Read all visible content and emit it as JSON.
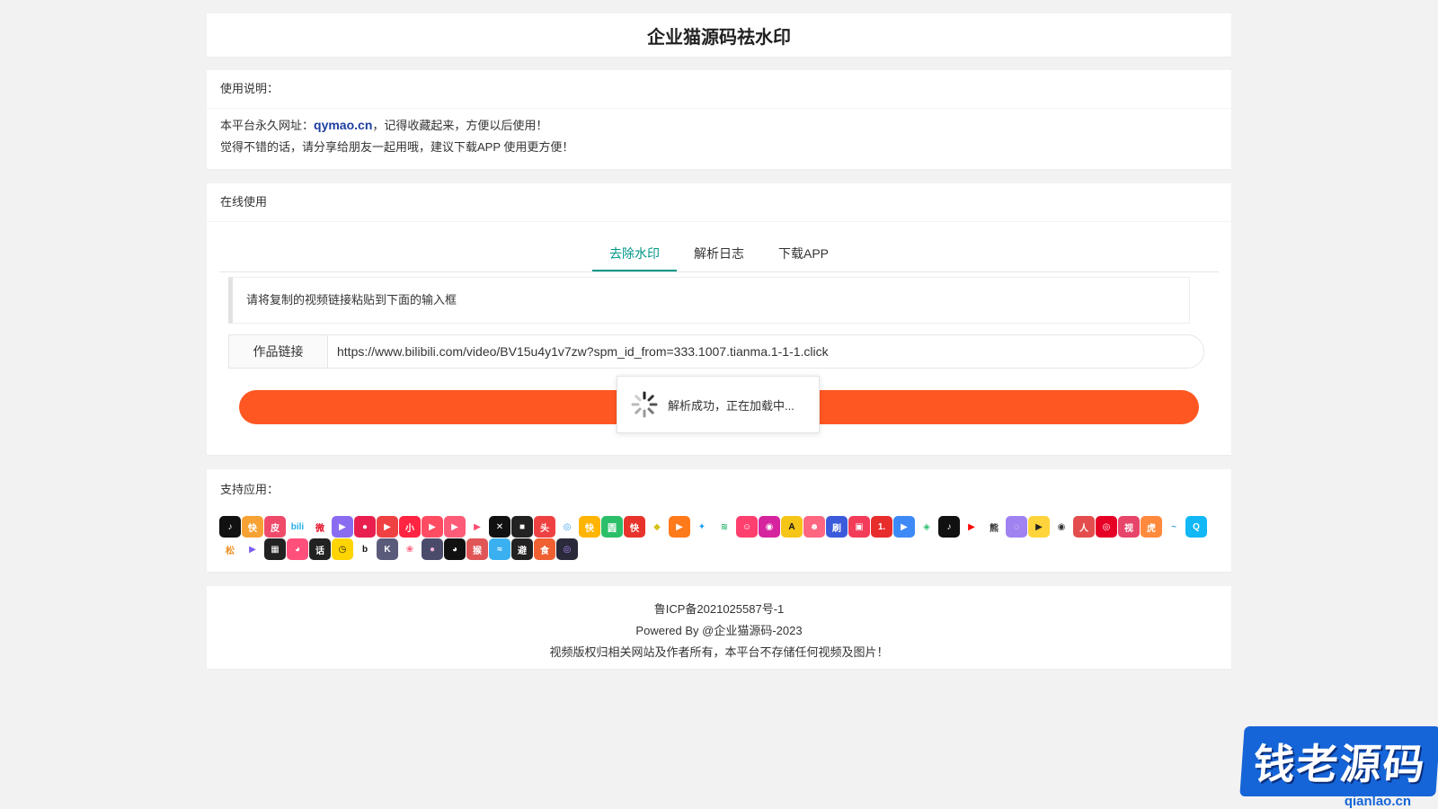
{
  "header": {
    "title": "企业猫源码祛水印"
  },
  "usage": {
    "heading": "使用说明：",
    "line1_prefix": "本平台永久网址：",
    "line1_link": "qymao.cn",
    "line1_suffix": "，记得收藏起来，方便以后使用！",
    "line2": "觉得不错的话，请分享给朋友一起用哦，建议下载APP 使用更方便！"
  },
  "online": {
    "heading": "在线使用",
    "tabs": [
      {
        "label": "去除水印",
        "active": true
      },
      {
        "label": "解析日志",
        "active": false
      },
      {
        "label": "下载APP",
        "active": false
      }
    ],
    "notice": "请将复制的视频链接粘贴到下面的输入框",
    "input_label": "作品链接",
    "input_value": "https://www.bilibili.com/video/BV15u4y1v7zw?spm_id_from=333.1007.tianma.1-1-1.click",
    "loading_text": "解析成功，正在加载中..."
  },
  "apps": {
    "heading": "支持应用：",
    "icons": [
      {
        "name": "douyin-icon",
        "glyph": "♪",
        "color": "#111111"
      },
      {
        "name": "kuaishou-icon",
        "glyph": "快",
        "color": "#f7a234"
      },
      {
        "name": "pipi-icon",
        "glyph": "皮",
        "color": "#ef4a6a"
      },
      {
        "name": "bilibili-icon",
        "glyph": "bili",
        "color": "#ffffff",
        "fg": "#23ade5"
      },
      {
        "name": "weibo-icon",
        "glyph": "微",
        "color": "#ffffff",
        "fg": "#e6162d"
      },
      {
        "name": "video-play-icon",
        "glyph": "▶",
        "color": "#8a6cf0"
      },
      {
        "name": "momo-icon",
        "glyph": "●",
        "color": "#e9204f"
      },
      {
        "name": "xigua-icon",
        "glyph": "▶",
        "color": "#f04142"
      },
      {
        "name": "xiaohongshu-icon",
        "glyph": "小",
        "color": "#ff2442"
      },
      {
        "name": "haokan-icon",
        "glyph": "▶",
        "color": "#ff4c62"
      },
      {
        "name": "weishi-icon",
        "glyph": "▶",
        "color": "#fd5b78"
      },
      {
        "name": "play-icon",
        "glyph": "▶",
        "color": "#ffffff",
        "fg": "#ff4b6e"
      },
      {
        "name": "jianying-icon",
        "glyph": "✕",
        "color": "#111111"
      },
      {
        "name": "video-cam-icon",
        "glyph": "■",
        "color": "#222222"
      },
      {
        "name": "toutiao-icon",
        "glyph": "头",
        "color": "#f04142"
      },
      {
        "name": "lens-icon",
        "glyph": "◎",
        "color": "#ffffff",
        "fg": "#3aa0e8"
      },
      {
        "name": "kuai-icon",
        "glyph": "快",
        "color": "#ffb400"
      },
      {
        "name": "green-app-icon",
        "glyph": "圆",
        "color": "#2cbf6a"
      },
      {
        "name": "kuaibao-icon",
        "glyph": "快",
        "color": "#e8332d"
      },
      {
        "name": "lemon-icon",
        "glyph": "◆",
        "color": "#ffffff",
        "fg": "#d4c41a"
      },
      {
        "name": "orange-play-icon",
        "glyph": "▶",
        "color": "#ff7a1a"
      },
      {
        "name": "twitter-icon",
        "glyph": "✦",
        "color": "#ffffff",
        "fg": "#1da1f2"
      },
      {
        "name": "wave-icon",
        "glyph": "≋",
        "color": "#ffffff",
        "fg": "#2bb673"
      },
      {
        "name": "smile-icon",
        "glyph": "☺",
        "color": "#ff3f6e"
      },
      {
        "name": "instagram-icon",
        "glyph": "◉",
        "color": "#d6249f"
      },
      {
        "name": "a-app-icon",
        "glyph": "A",
        "color": "#f5c518",
        "fg": "#111111"
      },
      {
        "name": "face-app-icon",
        "glyph": "☻",
        "color": "#ff6680"
      },
      {
        "name": "shua-icon",
        "glyph": "刷",
        "color": "#3b5bdb"
      },
      {
        "name": "red-play-icon",
        "glyph": "▣",
        "color": "#f23c5a"
      },
      {
        "name": "one-icon",
        "glyph": "1.",
        "color": "#e82d2d"
      },
      {
        "name": "blue-play-icon",
        "glyph": "▶",
        "color": "#3d8af7"
      },
      {
        "name": "eye-green-icon",
        "glyph": "◈",
        "color": "#ffffff",
        "fg": "#2fbf71"
      },
      {
        "name": "tiktok-icon",
        "glyph": "♪",
        "color": "#111111"
      },
      {
        "name": "youtube-icon",
        "glyph": "▶",
        "color": "#ffffff",
        "fg": "#ff0000"
      },
      {
        "name": "panda-icon",
        "glyph": "熊",
        "color": "#ffffff",
        "fg": "#333333"
      },
      {
        "name": "ghost-icon",
        "glyph": "◌",
        "color": "#a082f0"
      },
      {
        "name": "yellow-play-icon",
        "glyph": "▶",
        "color": "#ffd43b",
        "fg": "#222222"
      },
      {
        "name": "eye-dark-icon",
        "glyph": "◉",
        "color": "#ffffff",
        "fg": "#333333"
      },
      {
        "name": "portrait-icon",
        "glyph": "人",
        "color": "#e44d4d"
      },
      {
        "name": "netease-icon",
        "glyph": "◎",
        "color": "#e60026"
      },
      {
        "name": "shipin-icon",
        "glyph": "视",
        "color": "#e8456b"
      },
      {
        "name": "tiger-icon",
        "glyph": "虎",
        "color": "#ff8a3d"
      },
      {
        "name": "fish-icon",
        "glyph": "~",
        "color": "#ffffff",
        "fg": "#3a9ee8"
      },
      {
        "name": "qq-icon",
        "glyph": "Q",
        "color": "#12b7f5"
      },
      {
        "name": "squirrel-icon",
        "glyph": "松",
        "color": "#ffffff",
        "fg": "#f08c1a"
      },
      {
        "name": "purple-play-icon",
        "glyph": "▶",
        "color": "#ffffff",
        "fg": "#7b5cf0"
      },
      {
        "name": "stripe-icon",
        "glyph": "▦",
        "color": "#222222"
      },
      {
        "name": "pink-face-icon",
        "glyph": "◕",
        "color": "#ff4f7b"
      },
      {
        "name": "huaku-icon",
        "glyph": "话",
        "color": "#222222"
      },
      {
        "name": "clock-icon",
        "glyph": "◷",
        "color": "#ffd400",
        "fg": "#222222"
      },
      {
        "name": "b-icon",
        "glyph": "b",
        "color": "#ffffff",
        "fg": "#111111"
      },
      {
        "name": "k-icon",
        "glyph": "K",
        "color": "#5a5a7a"
      },
      {
        "name": "leaf-icon",
        "glyph": "❀",
        "color": "#ffffff",
        "fg": "#ff5a7a"
      },
      {
        "name": "circle-icon",
        "glyph": "●",
        "color": "#4a4a6a",
        "fg": "#f4b2d8"
      },
      {
        "name": "mascot-icon",
        "glyph": "◕",
        "color": "#111111"
      },
      {
        "name": "monkey-icon",
        "glyph": "猴",
        "color": "#e05555"
      },
      {
        "name": "water-icon",
        "glyph": "≈",
        "color": "#3ab0f0"
      },
      {
        "name": "bikan-icon",
        "glyph": "避",
        "color": "#222222"
      },
      {
        "name": "food-icon",
        "glyph": "食",
        "color": "#f06030"
      },
      {
        "name": "dark-ring-icon",
        "glyph": "◎",
        "color": "#2a2a3a",
        "fg": "#b388ff"
      }
    ]
  },
  "footer": {
    "icp": "鲁ICP备2021025587号-1",
    "powered": "Powered By @企业猫源码-2023",
    "disclaimer": "视频版权归相关网站及作者所有，本平台不存储任何视频及图片！"
  },
  "watermark": {
    "text": "钱老源码",
    "url": "qianlao.cn"
  }
}
